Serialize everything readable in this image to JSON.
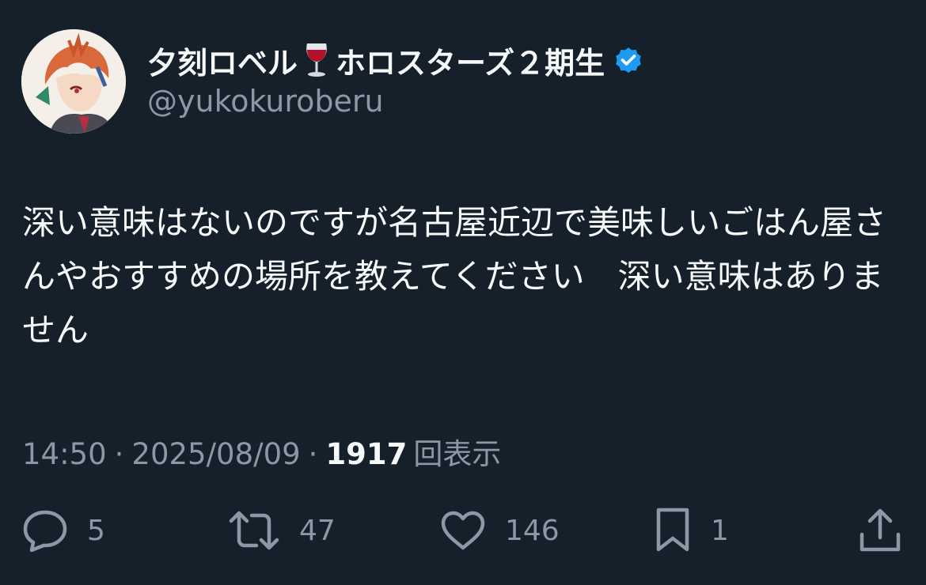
{
  "user": {
    "display_name_part1": "夕刻ロベル",
    "display_name_part2": "ホロスターズ２期生",
    "emoji_icon": "wine-glass-icon",
    "verified_icon": "verified-badge-icon",
    "handle": "@yukokuroberu"
  },
  "tweet": {
    "text": "深い意味はないのですが名古屋近辺で美味しいごはん屋さんやおすすめの場所を教えてください　深い意味はありません",
    "time": "14:50",
    "date": "2025/08/09",
    "separator": "·",
    "views_count": "1917",
    "views_label": "回表示"
  },
  "actions": {
    "reply_count": "5",
    "retweet_count": "47",
    "like_count": "146",
    "bookmark_count": "1"
  },
  "colors": {
    "background": "#15202b",
    "text_primary": "#f7f9f9",
    "text_secondary": "#8b98a5",
    "verified": "#1d9bf0"
  }
}
